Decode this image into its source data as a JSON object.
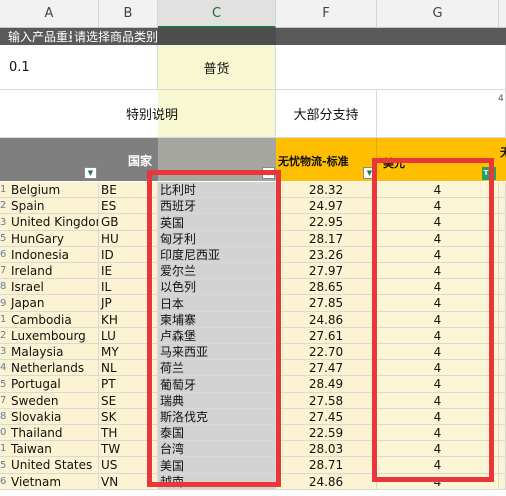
{
  "columns": [
    "A",
    "B",
    "C",
    "F",
    "G"
  ],
  "row1": {
    "col_a": "输入产品重量",
    "col_b": "请选择商品类别"
  },
  "row2": {
    "col_a": "0.1",
    "col_c": "普货"
  },
  "row3": {
    "special_note": "特别说明",
    "f_value": "大部分支持",
    "h_value": "4"
  },
  "header": {
    "country": "国家",
    "shipping": "无忧物流-标准",
    "g_header": "美元",
    "h_header": "无"
  },
  "filter_glyph": "▼",
  "sort_glyph": "T↓",
  "rows": [
    {
      "rownum": "1",
      "country": "Belgium",
      "code": "BE",
      "cn": "比利时",
      "price": "28.32",
      "days": "4"
    },
    {
      "rownum": "2",
      "country": "Spain",
      "code": "ES",
      "cn": "西班牙",
      "price": "24.97",
      "days": "4"
    },
    {
      "rownum": "3",
      "country": "United Kingdom",
      "code": "GB",
      "cn": "英国",
      "price": "22.95",
      "days": "4"
    },
    {
      "rownum": "5",
      "country": "HunGary",
      "code": "HU",
      "cn": "匈牙利",
      "price": "28.17",
      "days": "4"
    },
    {
      "rownum": "6",
      "country": "Indonesia",
      "code": "ID",
      "cn": "印度尼西亚",
      "price": "23.26",
      "days": "4"
    },
    {
      "rownum": "7",
      "country": "Ireland",
      "code": "IE",
      "cn": "爱尔兰",
      "price": "27.97",
      "days": "4"
    },
    {
      "rownum": "8",
      "country": "Israel",
      "code": "IL",
      "cn": "以色列",
      "price": "28.65",
      "days": "4"
    },
    {
      "rownum": "9",
      "country": "Japan",
      "code": "JP",
      "cn": "日本",
      "price": "27.85",
      "days": "4"
    },
    {
      "rownum": "1",
      "country": "Cambodia",
      "code": "KH",
      "cn": "柬埔寨",
      "price": "24.86",
      "days": "4"
    },
    {
      "rownum": "2",
      "country": "Luxembourg",
      "code": "LU",
      "cn": "卢森堡",
      "price": "27.61",
      "days": "4"
    },
    {
      "rownum": "3",
      "country": "Malaysia",
      "code": "MY",
      "cn": "马来西亚",
      "price": "22.70",
      "days": "4"
    },
    {
      "rownum": "4",
      "country": "Netherlands",
      "code": "NL",
      "cn": "荷兰",
      "price": "27.47",
      "days": "4"
    },
    {
      "rownum": "5",
      "country": "Portugal",
      "code": "PT",
      "cn": "葡萄牙",
      "price": "28.49",
      "days": "4"
    },
    {
      "rownum": "7",
      "country": "Sweden",
      "code": "SE",
      "cn": "瑞典",
      "price": "27.58",
      "days": "4"
    },
    {
      "rownum": "8",
      "country": "Slovakia",
      "code": "SK",
      "cn": "斯洛伐克",
      "price": "27.45",
      "days": "4"
    },
    {
      "rownum": "0",
      "country": "Thailand",
      "code": "TH",
      "cn": "泰国",
      "price": "22.59",
      "days": "4"
    },
    {
      "rownum": "1",
      "country": "Taiwan",
      "code": "TW",
      "cn": "台湾",
      "price": "28.03",
      "days": "4"
    },
    {
      "rownum": "5",
      "country": "United States",
      "code": "US",
      "cn": "美国",
      "price": "28.71",
      "days": "4"
    },
    {
      "rownum": "6",
      "country": "Vietnam",
      "code": "VN",
      "cn": "越南",
      "price": "24.86",
      "days": "4"
    }
  ],
  "colors": {
    "header_dark": "#595959",
    "row_light": "#fcf3d3",
    "col_c_light": "#f7f7d1",
    "col_c_rows": "#d3d3d3",
    "col_g_rows": "#fcf5d6",
    "orange_header": "#ffbe00",
    "gray_header": "#828282",
    "red_box": "#e8363b",
    "selection": "#217346"
  }
}
